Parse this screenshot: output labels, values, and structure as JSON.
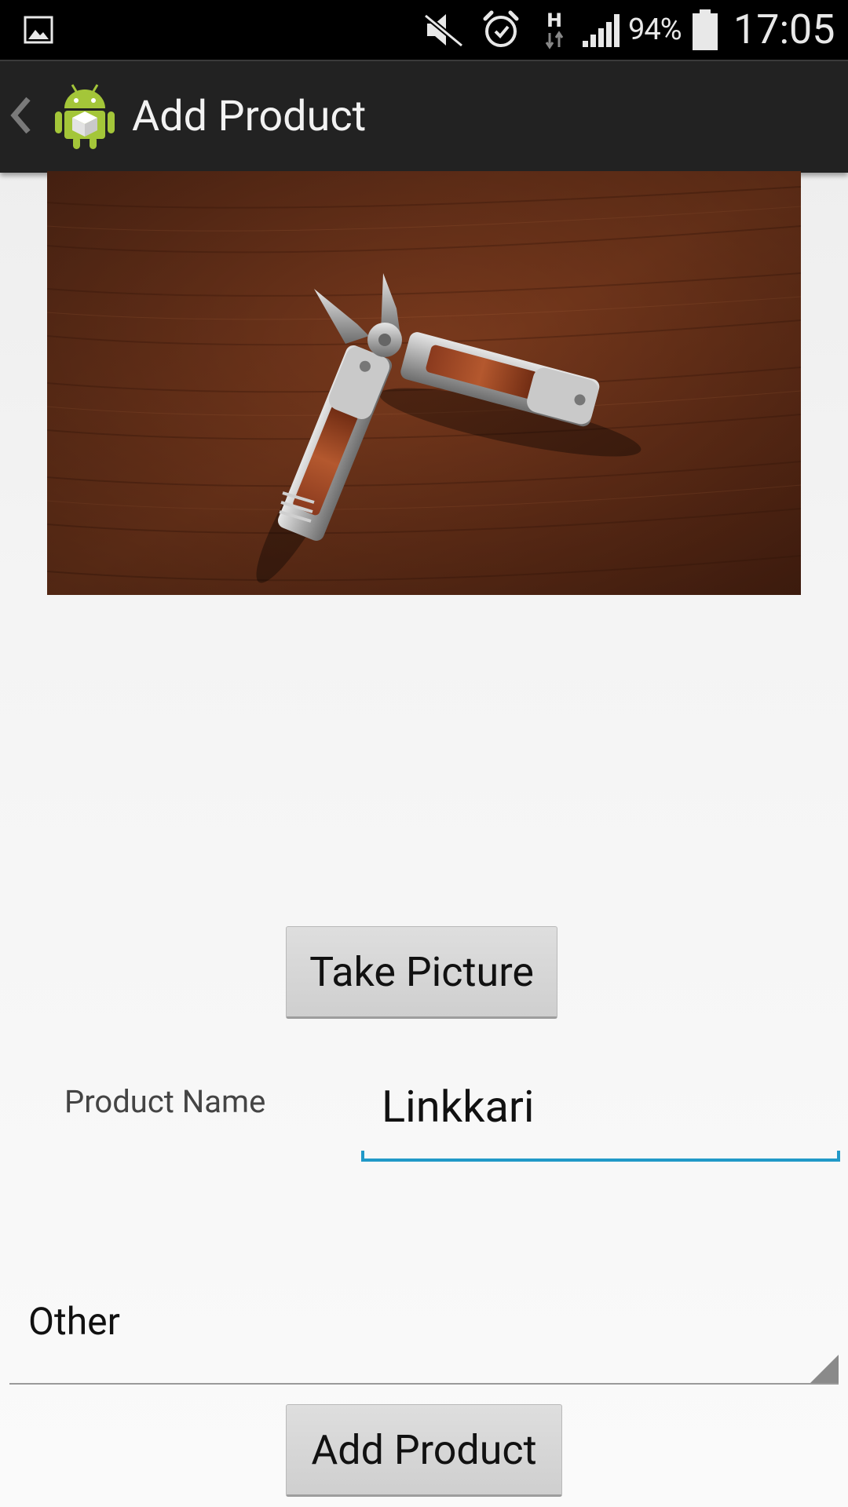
{
  "status_bar": {
    "icons": [
      "gallery-icon",
      "mute-icon",
      "alarm-icon",
      "hspa-icon",
      "signal-icon",
      "battery-icon"
    ],
    "network_type": "H",
    "battery": "94%",
    "time": "17:05"
  },
  "action_bar": {
    "title": "Add Product",
    "app_icon": "android-robot-icon",
    "background": "#222222"
  },
  "photo": {
    "subject": "multi-tool pliers on wooden table"
  },
  "buttons": {
    "take_picture": "Take Picture",
    "add_product": "Add Product"
  },
  "form": {
    "product_name_label": "Product Name",
    "product_name_value": "Linkkari",
    "category_value": "Other"
  },
  "colors": {
    "accent": "#2199c8",
    "button": "#d6d6d6",
    "background": "#f3f3f3"
  }
}
